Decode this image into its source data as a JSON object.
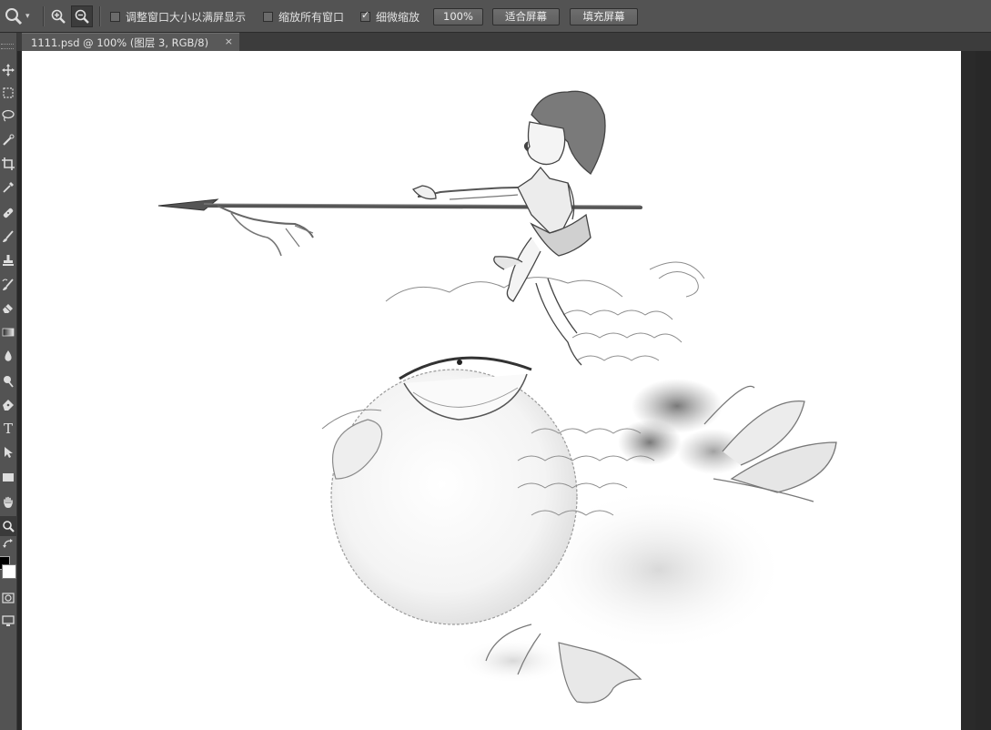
{
  "options_bar": {
    "checkbox_resize_windows": {
      "label": "调整窗口大小以满屏显示",
      "checked": false
    },
    "checkbox_zoom_all": {
      "label": "缩放所有窗口",
      "checked": false
    },
    "checkbox_scrubby_zoom": {
      "label": "细微缩放",
      "checked": true
    },
    "btn_100": "100%",
    "btn_fit": "适合屏幕",
    "btn_fill": "填充屏幕"
  },
  "document_tab": {
    "title": "1111.psd @ 100% (图层 3, RGB/8)",
    "close_glyph": "×"
  },
  "toolbar": {
    "type_tool_glyph": "T",
    "foreground_color": "#000000",
    "background_color": "#ffffff"
  }
}
